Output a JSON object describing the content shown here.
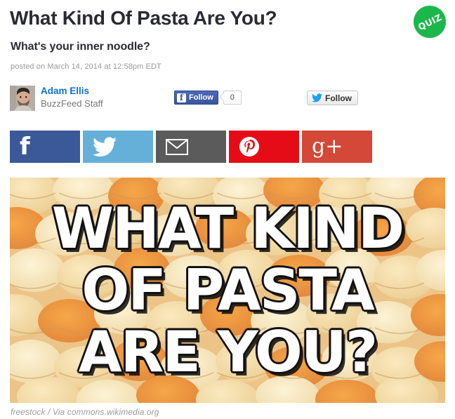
{
  "article": {
    "title": "What Kind Of Pasta Are You?",
    "subtitle": "What's your inner noodle?",
    "timestamp": "posted on March 14, 2014 at 12:58pm EDT",
    "badge_label": "QUIZ"
  },
  "byline": {
    "author_name": "Adam Ellis",
    "author_role": "BuzzFeed Staff",
    "avatar_name": "author-avatar-photo"
  },
  "follow": {
    "facebook_label": "Follow",
    "facebook_count": "0",
    "twitter_label": "Follow"
  },
  "share": {
    "buttons": [
      {
        "name": "share-facebook",
        "label": "Facebook",
        "icon": "facebook-icon",
        "color": "#3b5998"
      },
      {
        "name": "share-twitter",
        "label": "Twitter",
        "icon": "twitter-icon",
        "color": "#64b0d9"
      },
      {
        "name": "share-email",
        "label": "Email",
        "icon": "envelope-icon",
        "color": "#5b5b5b"
      },
      {
        "name": "share-pinterest",
        "label": "Pinterest",
        "icon": "pinterest-icon",
        "color": "#e60c17"
      },
      {
        "name": "share-googleplus",
        "label": "Google Plus",
        "icon": "google-plus-icon",
        "color": "#d34836"
      }
    ]
  },
  "hero": {
    "line1": "WHAT KIND",
    "line2": "OF PASTA",
    "line3": "ARE YOU?",
    "caption": "freestock / Via commons.wikimedia.org"
  },
  "colors": {
    "title": "#2a2a33",
    "link": "#0b6fd4",
    "muted": "#9a9a9a",
    "quiz_green": "#1ab84a"
  }
}
